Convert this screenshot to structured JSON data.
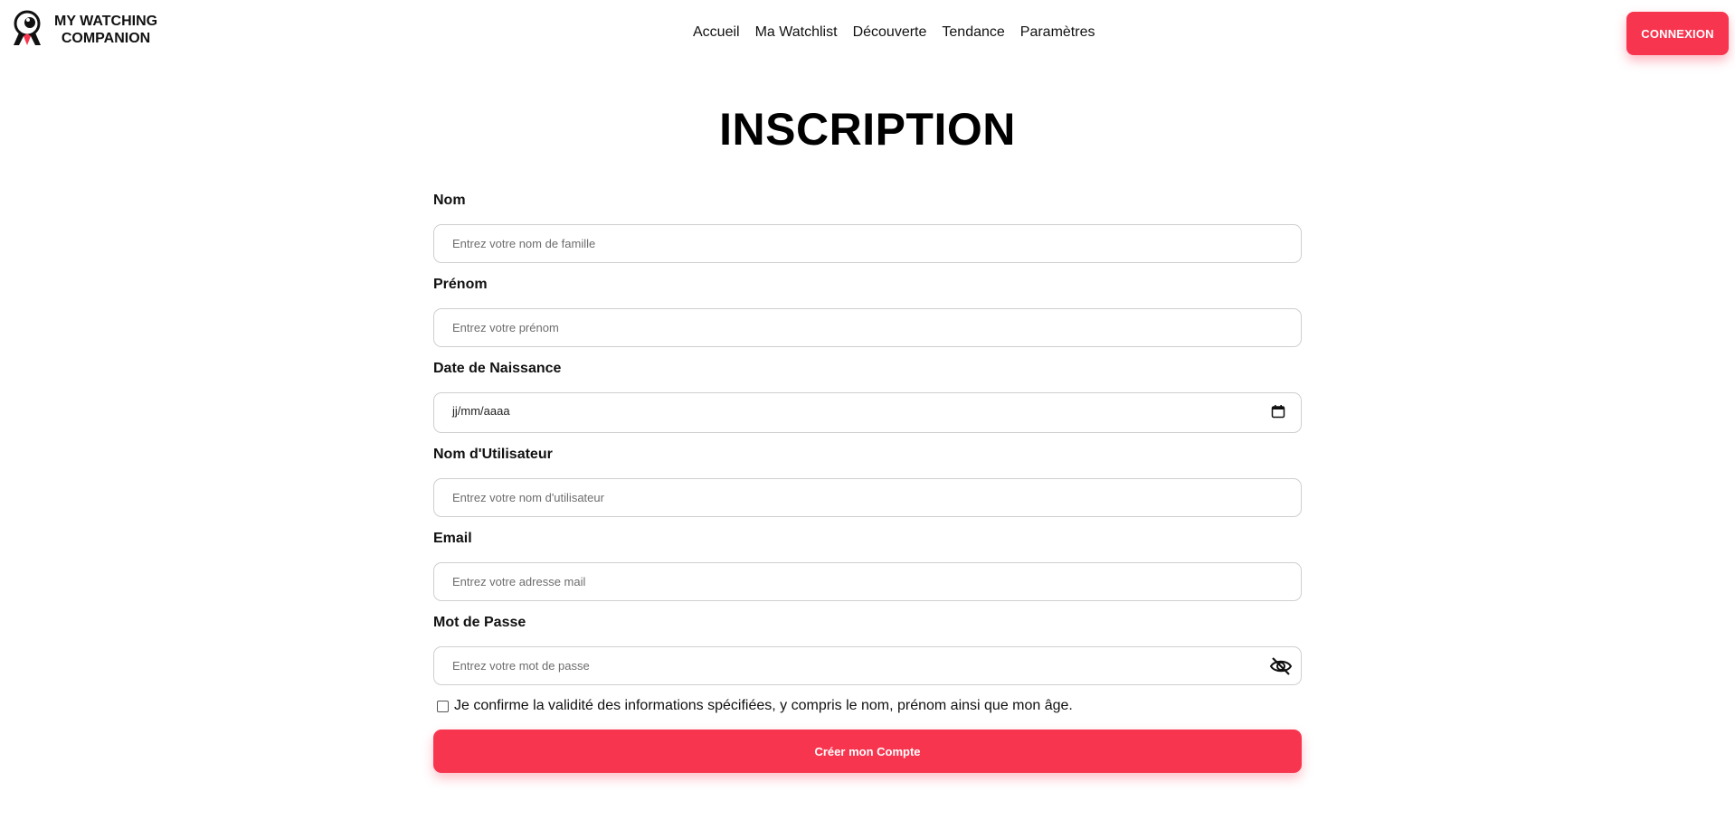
{
  "header": {
    "logo": {
      "line1": "MY WATCHING",
      "line2": "COMPANION"
    },
    "nav": [
      "Accueil",
      "Ma Watchlist",
      "Découverte",
      "Tendance",
      "Paramètres"
    ],
    "login_label": "CONNEXION"
  },
  "page": {
    "title": "INSCRIPTION"
  },
  "form": {
    "nom": {
      "label": "Nom",
      "placeholder": "Entrez votre nom de famille"
    },
    "prenom": {
      "label": "Prénom",
      "placeholder": "Entrez votre prénom"
    },
    "birthdate": {
      "label": "Date de Naissance",
      "value": "jj/mm/aaaa"
    },
    "username": {
      "label": "Nom d'Utilisateur",
      "placeholder": "Entrez votre nom d'utilisateur"
    },
    "email": {
      "label": "Email",
      "placeholder": "Entrez votre adresse mail"
    },
    "password": {
      "label": "Mot de Passe",
      "placeholder": "Entrez votre mot de passe"
    },
    "confirm_label": "Je confirme la validité des informations spécifiées, y compris le nom, prénom ainsi que mon âge.",
    "submit_label": "Créer mon Compte"
  },
  "colors": {
    "accent": "#f8354f",
    "text": "#111111",
    "border": "#cfcfcf"
  },
  "icons": {
    "logo": "watching-companion-logo",
    "calendar": "calendar-icon",
    "eye": "eye-slash-icon"
  }
}
